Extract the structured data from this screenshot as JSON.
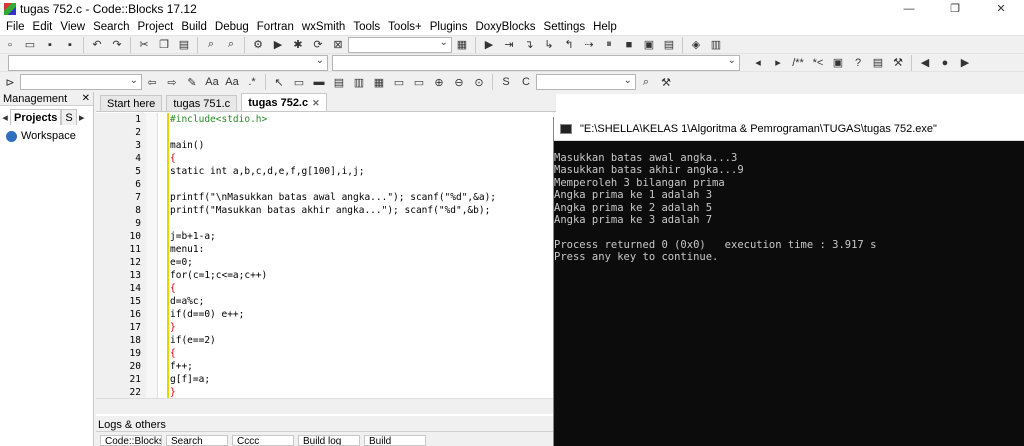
{
  "window": {
    "title": "tugas 752.c - Code::Blocks 17.12"
  },
  "menu": [
    "File",
    "Edit",
    "View",
    "Search",
    "Project",
    "Build",
    "Debug",
    "Fortran",
    "wxSmith",
    "Tools",
    "Tools+",
    "Plugins",
    "DoxyBlocks",
    "Settings",
    "Help"
  ],
  "management": {
    "title": "Management",
    "tabs": [
      "Projects",
      "S"
    ],
    "workspace": "Workspace"
  },
  "editor": {
    "tabs": [
      "Start here",
      "tugas 751.c",
      "tugas 752.c"
    ],
    "active_tab": "tugas 752.c",
    "line_numbers": [
      "1",
      "2",
      "3",
      "4",
      "5",
      "6",
      "7",
      "8",
      "9",
      "10",
      "11",
      "12",
      "13",
      "14",
      "15",
      "16",
      "17",
      "18",
      "19",
      "20",
      "21",
      "22"
    ],
    "lines": [
      "#include<stdio.h>",
      "",
      "main()",
      "{",
      "static int a,b,c,d,e,f,g[100],i,j;",
      "",
      "printf(\"\\nMasukkan batas awal angka...\"); scanf(\"%d\",&a);",
      "printf(\"Masukkan batas akhir angka...\"); scanf(\"%d\",&b);",
      "",
      "j=b+1-a;",
      "menu1:",
      "e=0;",
      "for(c=1;c<=a;c++)",
      "{",
      "d=a%c;",
      "if(d==0) e++;",
      "}",
      "if(e==2)",
      "{",
      "f++;",
      "g[f]=a;",
      "}"
    ]
  },
  "console": {
    "title": "\"E:\\SHELLA\\KELAS 1\\Algoritma & Pemrograman\\TUGAS\\tugas 752.exe\"",
    "lines": [
      "Masukkan batas awal angka...3",
      "Masukkan batas akhir angka...9",
      "Memperoleh 3 bilangan prima",
      "Angka prima ke 1 adalah 3",
      "Angka prima ke 2 adalah 5",
      "Angka prima ke 3 adalah 7",
      "",
      "Process returned 0 (0x0)   execution time : 3.917 s",
      "Press any key to continue."
    ]
  },
  "logs": {
    "title": "Logs & others",
    "tabs": [
      "Code::Blocks",
      "Search results",
      "Cccc",
      "Build log",
      "Build messages"
    ]
  },
  "colors": {
    "console_bg": "#0c0c0c",
    "console_fg": "#c8c8c8",
    "change_bar": "#e7d600",
    "preprocessor": "#2a8a2a"
  }
}
